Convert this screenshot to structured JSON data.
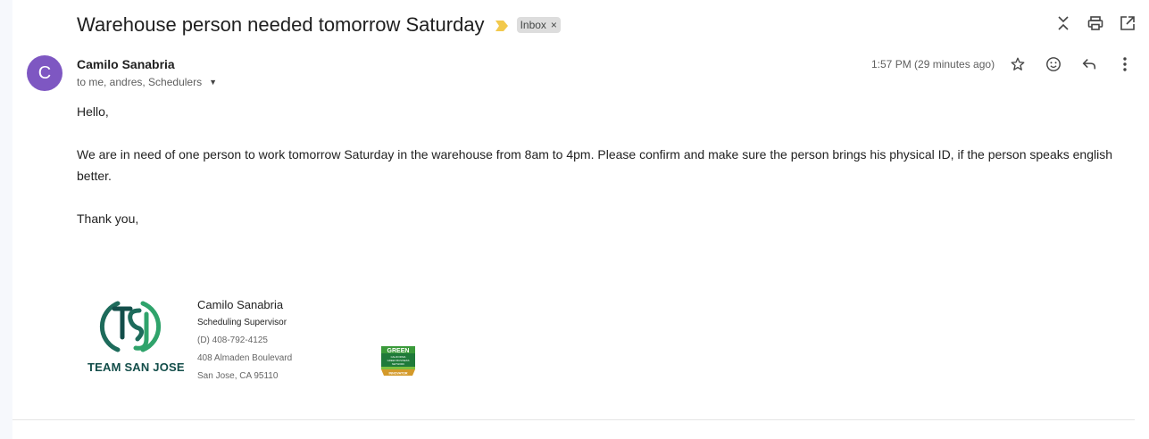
{
  "email": {
    "subject": "Warehouse person needed tomorrow Saturday",
    "label": "Inbox",
    "label_remove": "×",
    "sender": {
      "initial": "C",
      "name": "Camilo Sanabria",
      "recipients": "to me, andres, Schedulers",
      "avatar_color": "#7e57c2"
    },
    "timestamp": "1:57 PM (29 minutes ago)",
    "body": {
      "greeting": "Hello,",
      "paragraph": "We are in need of one person to work tomorrow Saturday in the warehouse from 8am to 4pm.  Please confirm and make sure the person brings his physical ID, if the person speaks english better.",
      "closing": "Thank you,"
    },
    "signature": {
      "name": "Camilo Sanabria",
      "title": "Scheduling Supervisor",
      "phone": "(D) 408-792-4125",
      "address1": "408 Almaden Boulevard",
      "address2": "San Jose, CA 95110",
      "logo_text": "TEAM SAN JOSE",
      "badge": {
        "top": "GREEN",
        "middle": "CALIFORNIA GREEN BUSINESS NETWORK",
        "bottom": "INNOVATOR"
      }
    }
  },
  "icons": {
    "importance": "importance-marker-icon",
    "collapse": "collapse-all-icon",
    "print": "print-icon",
    "popout": "open-in-new-window-icon",
    "star": "star-icon",
    "emoji": "emoji-reaction-icon",
    "reply": "reply-icon",
    "more": "more-vert-icon"
  },
  "colors": {
    "accent_importance": "#f2c94c",
    "logo_green": "#1d6b5b"
  }
}
